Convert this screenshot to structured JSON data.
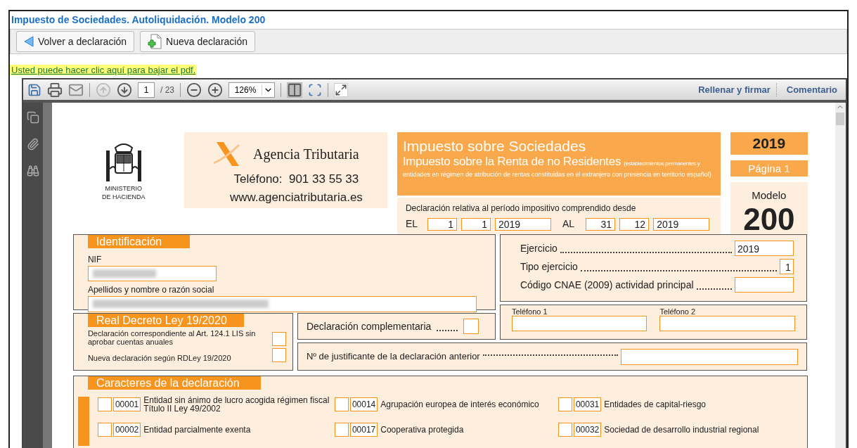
{
  "window": {
    "title": "Impuesto de Sociedades. Autoliquidación. Modelo 200"
  },
  "toolbar": {
    "buttons": [
      {
        "label": "Volver a declaración",
        "kind": "back"
      },
      {
        "label": "Nueva declaración",
        "kind": "new"
      }
    ]
  },
  "download_link": "Usted puede hacer clic aquí para bajar el pdf.",
  "viewer": {
    "page_input": "1",
    "page_total": "/ 23",
    "zoom": "126%",
    "actions": [
      "Rellenar y firmar",
      "Comentario"
    ]
  },
  "form": {
    "ministry": [
      "MINISTERIO",
      "DE HACIENDA"
    ],
    "agency": {
      "name": "Agencia Tributaria",
      "phone": "Teléfono:  901 33 55 33",
      "web": "www.agenciatributaria.es"
    },
    "title": {
      "line1": "Impuesto sobre Sociedades",
      "line2": "Impuesto sobre la Renta de no Residentes",
      "note_start": "(establecimientos permanentes y",
      "note_rest": "entidades en régimen de atribución de rentas constituidas en el extranjero con presencia en territorio español)"
    },
    "period": {
      "label": "Declaración relativa al período impositivo comprendido desde",
      "from_label": "EL",
      "from": [
        "1",
        "1",
        "2019"
      ],
      "to_label": "AL",
      "to": [
        "31",
        "12",
        "2019"
      ]
    },
    "year": "2019",
    "page": "Página 1",
    "model_label": "Modelo",
    "model": "200",
    "identificacion": {
      "heading": "Identificación",
      "nif_label": "NIF",
      "name_label": "Apellidos y nombre o razón social"
    },
    "ejercicio": [
      {
        "label": "Ejercicio",
        "value": "2019"
      },
      {
        "label": "Tipo ejercicio",
        "value": "1"
      },
      {
        "label": "Código CNAE (2009) actividad principal"
      }
    ],
    "real_decreto": {
      "heading": "Real Decreto Ley 19/2020",
      "items": [
        {
          "label": "Declaración correspondiente al Art. 124.1 LIS sin aprobar cuentas anuales",
          "checked": false
        },
        {
          "label": "Nueva declaración según RDLey 19/2020",
          "checked": false
        }
      ]
    },
    "complementaria": {
      "label": "Declaración complementaria",
      "checked": false
    },
    "telefonos": [
      "Teléfono 1",
      "Teléfono 2"
    ],
    "justificante": "Nº de justificante de la declaración anterior",
    "caracteres": {
      "heading": "Caracteres de la declaración",
      "items": [
        {
          "code": "00001",
          "label": "Entidad sin ánimo de lucro acogida régimen fiscal Título II Ley 49/2002",
          "checked": false
        },
        {
          "code": "00014",
          "label": "Agrupación europea de interés económico",
          "checked": false
        },
        {
          "code": "00031",
          "label": "Entidades de capital-riesgo",
          "checked": false
        },
        {
          "code": "00002",
          "label": "Entidad parcialmente exenta",
          "checked": false
        },
        {
          "code": "00017",
          "label": "Cooperativa protegida",
          "checked": false
        },
        {
          "code": "00032",
          "label": "Sociedad de desarrollo industrial regional",
          "checked": false
        }
      ]
    }
  }
}
